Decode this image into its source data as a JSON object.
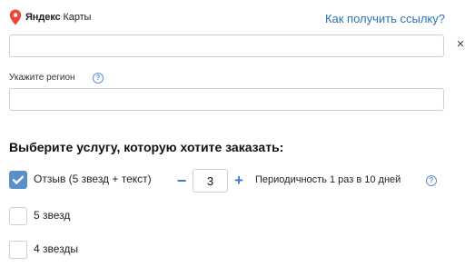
{
  "header": {
    "brand_bold": "Яндекс",
    "brand_rest": " Карты",
    "help_link": "Как получить ссылку?"
  },
  "url_field": {
    "value": "",
    "clear_symbol": "×"
  },
  "region": {
    "label": "Укажите регион",
    "help_symbol": "?",
    "value": ""
  },
  "services": {
    "title": "Выберите услугу, которую хотите заказать:",
    "options": [
      {
        "label": "Отзыв (5 звезд + текст)",
        "checked": true
      },
      {
        "label": "5 звезд",
        "checked": false
      },
      {
        "label": "4 звезды",
        "checked": false
      }
    ],
    "stepper": {
      "minus": "−",
      "value": "3",
      "plus": "+"
    },
    "periodicity_label": "Периодичность 1 раз в 10 дней",
    "periodicity_help": "?"
  },
  "colors": {
    "link": "#2c73b8",
    "accent": "#5a8fc8",
    "brand_pin": "#f44336"
  },
  "icons": {
    "brand": "map-pin-icon",
    "clear": "close-icon",
    "help": "question-circle-icon",
    "check": "checkmark-icon"
  }
}
